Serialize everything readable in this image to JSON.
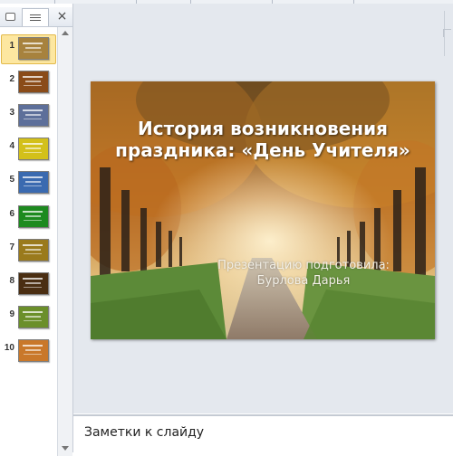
{
  "thumbnails_panel": {
    "close_glyph": "×",
    "slides": [
      {
        "number": "1",
        "color": "#a7823d",
        "selected": true
      },
      {
        "number": "2",
        "color": "#8a4b18",
        "selected": false
      },
      {
        "number": "3",
        "color": "#5d6f9a",
        "selected": false
      },
      {
        "number": "4",
        "color": "#d3c01a",
        "selected": false
      },
      {
        "number": "5",
        "color": "#3a6ab0",
        "selected": false
      },
      {
        "number": "6",
        "color": "#1d8a1f",
        "selected": false
      },
      {
        "number": "7",
        "color": "#9a7a1c",
        "selected": false
      },
      {
        "number": "8",
        "color": "#4a2e12",
        "selected": false
      },
      {
        "number": "9",
        "color": "#6b8f2a",
        "selected": false
      },
      {
        "number": "10",
        "color": "#c9782a",
        "selected": false
      }
    ]
  },
  "slide": {
    "title": "История возникновения праздника: «День Учителя»",
    "subtitle": "Презентацию подготовила: Бурлова Дарья"
  },
  "notes": {
    "placeholder": "Заметки к слайду"
  },
  "colors": {
    "selection": "#fde7a0",
    "selection_border": "#e2b94a",
    "workspace": "#e4e8ee"
  }
}
